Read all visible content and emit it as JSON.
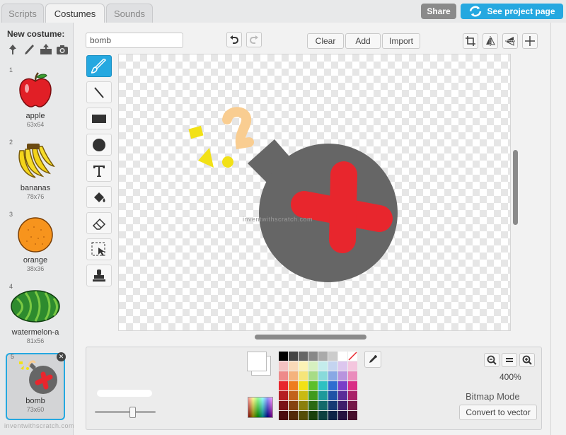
{
  "tabs": [
    {
      "label": "Scripts"
    },
    {
      "label": "Costumes"
    },
    {
      "label": "Sounds"
    }
  ],
  "header": {
    "share_label": "Share",
    "project_page_label": "See project page"
  },
  "costume_panel": {
    "new_costume_label": "New costume:",
    "new_icons": [
      "paint-brush-icon",
      "choose-from-library-icon",
      "upload-icon",
      "camera-icon"
    ],
    "costumes": [
      {
        "num": "1",
        "name": "apple",
        "size": "63x64"
      },
      {
        "num": "2",
        "name": "bananas",
        "size": "78x76"
      },
      {
        "num": "3",
        "name": "orange",
        "size": "38x36"
      },
      {
        "num": "4",
        "name": "watermelon-a",
        "size": "81x56"
      },
      {
        "num": "5",
        "name": "bomb",
        "size": "73x60",
        "selected": true
      }
    ]
  },
  "editor": {
    "costume_name": "bomb",
    "clear_label": "Clear",
    "add_label": "Add",
    "import_label": "Import",
    "zoom_level": "400%",
    "mode_label": "Bitmap Mode",
    "convert_label": "Convert to vector",
    "watermark": "inventwithscratch.com",
    "watermark_bottom": "inventwithscratch.com"
  },
  "colors": {
    "accent": "#25a8e0",
    "bomb_body": "#666666",
    "bomb_cross": "#e8262d",
    "fuse": "#f9cd91",
    "spark": "#f2e116"
  }
}
